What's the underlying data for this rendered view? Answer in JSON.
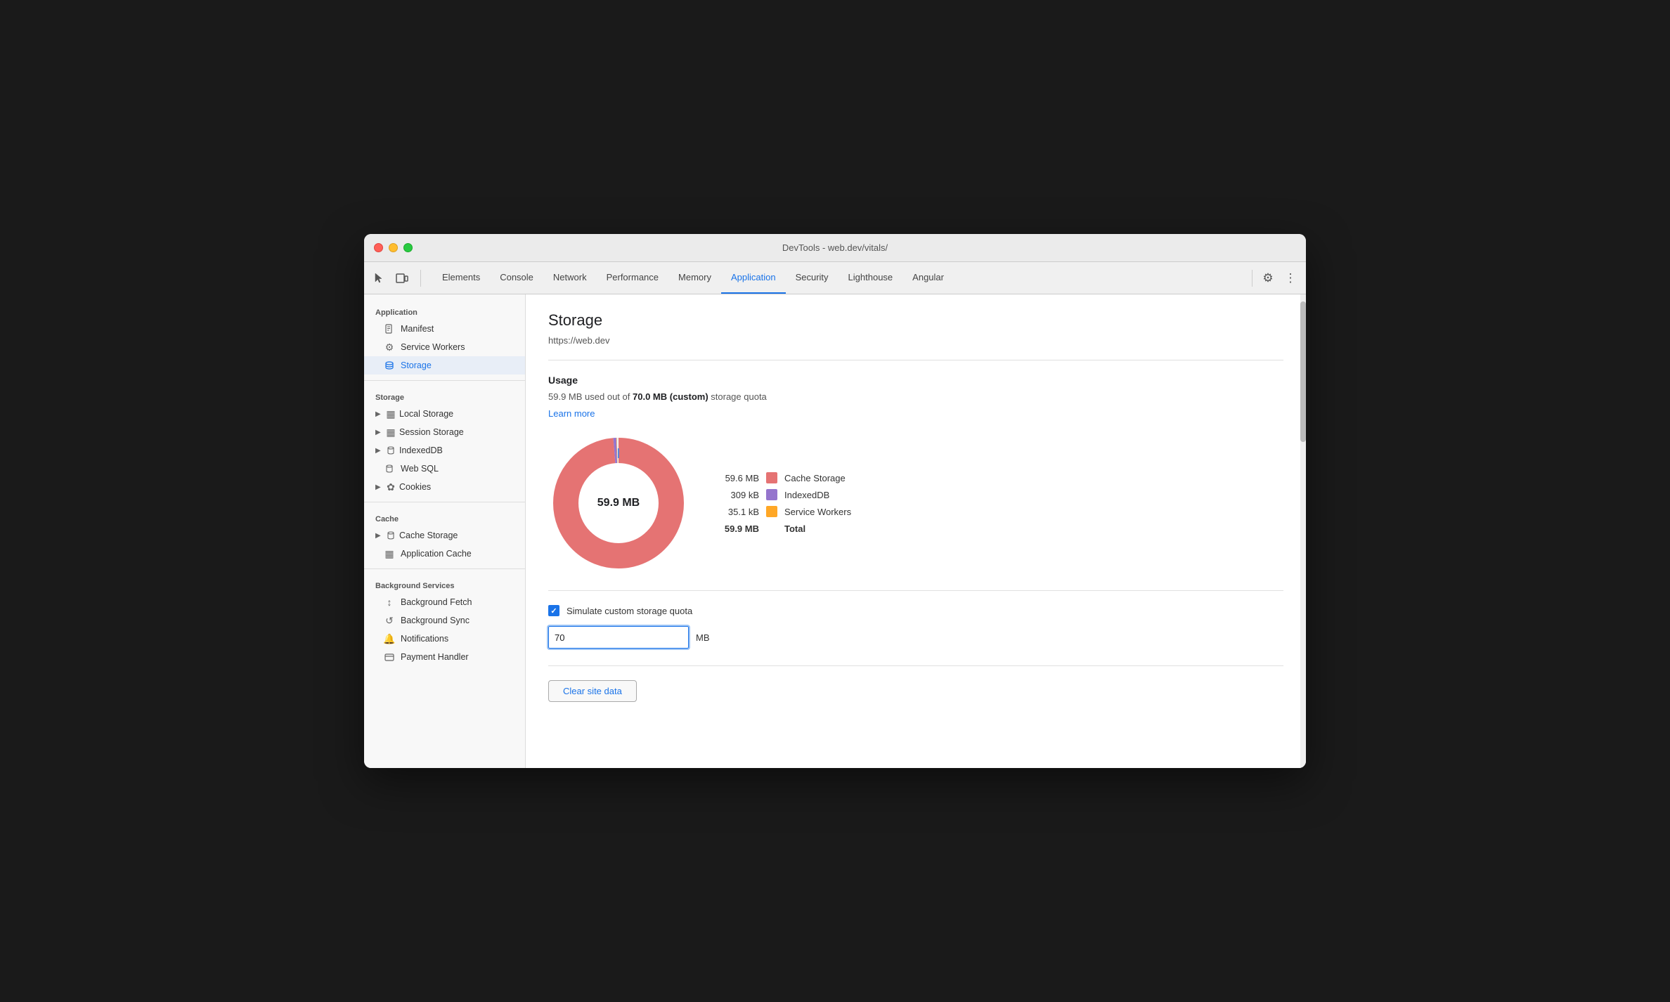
{
  "window": {
    "title": "DevTools - web.dev/vitals/"
  },
  "toolbar": {
    "icons": [
      {
        "name": "cursor-icon",
        "symbol": "⬚"
      },
      {
        "name": "device-icon",
        "symbol": "▣"
      }
    ],
    "tabs": [
      {
        "id": "elements",
        "label": "Elements",
        "active": false
      },
      {
        "id": "console",
        "label": "Console",
        "active": false
      },
      {
        "id": "network",
        "label": "Network",
        "active": false
      },
      {
        "id": "performance",
        "label": "Performance",
        "active": false
      },
      {
        "id": "memory",
        "label": "Memory",
        "active": false
      },
      {
        "id": "application",
        "label": "Application",
        "active": true
      },
      {
        "id": "security",
        "label": "Security",
        "active": false
      },
      {
        "id": "lighthouse",
        "label": "Lighthouse",
        "active": false
      },
      {
        "id": "angular",
        "label": "Angular",
        "active": false
      }
    ],
    "actions": [
      {
        "name": "settings-icon",
        "symbol": "⚙"
      },
      {
        "name": "more-icon",
        "symbol": "⋮"
      }
    ]
  },
  "sidebar": {
    "sections": [
      {
        "label": "Application",
        "items": [
          {
            "id": "manifest",
            "label": "Manifest",
            "icon": "📄",
            "active": false,
            "expandable": false
          },
          {
            "id": "service-workers",
            "label": "Service Workers",
            "icon": "⚙",
            "active": false,
            "expandable": false
          },
          {
            "id": "storage",
            "label": "Storage",
            "icon": "🗄",
            "active": true,
            "expandable": false
          }
        ]
      },
      {
        "label": "Storage",
        "items": [
          {
            "id": "local-storage",
            "label": "Local Storage",
            "icon": "▦",
            "active": false,
            "expandable": true
          },
          {
            "id": "session-storage",
            "label": "Session Storage",
            "icon": "▦",
            "active": false,
            "expandable": true
          },
          {
            "id": "indexeddb",
            "label": "IndexedDB",
            "icon": "🗄",
            "active": false,
            "expandable": true
          },
          {
            "id": "web-sql",
            "label": "Web SQL",
            "icon": "🗄",
            "active": false,
            "expandable": false
          },
          {
            "id": "cookies",
            "label": "Cookies",
            "icon": "✿",
            "active": false,
            "expandable": true
          }
        ]
      },
      {
        "label": "Cache",
        "items": [
          {
            "id": "cache-storage",
            "label": "Cache Storage",
            "icon": "🗄",
            "active": false,
            "expandable": true
          },
          {
            "id": "application-cache",
            "label": "Application Cache",
            "icon": "▦",
            "active": false,
            "expandable": false
          }
        ]
      },
      {
        "label": "Background Services",
        "items": [
          {
            "id": "background-fetch",
            "label": "Background Fetch",
            "icon": "↕",
            "active": false,
            "expandable": false
          },
          {
            "id": "background-sync",
            "label": "Background Sync",
            "icon": "↺",
            "active": false,
            "expandable": false
          },
          {
            "id": "notifications",
            "label": "Notifications",
            "icon": "🔔",
            "active": false,
            "expandable": false
          },
          {
            "id": "payment-handler",
            "label": "Payment Handler",
            "icon": "▬",
            "active": false,
            "expandable": false
          }
        ]
      }
    ]
  },
  "content": {
    "title": "Storage",
    "url": "https://web.dev",
    "usage": {
      "section_title": "Usage",
      "used": "59.9 MB",
      "total": "70.0 MB",
      "quota_type": "(custom)",
      "suffix": "storage quota",
      "prefix": "used out of",
      "learn_more": "Learn more"
    },
    "chart": {
      "center_label": "59.9 MB",
      "segments": [
        {
          "label": "Cache Storage",
          "value": "59.6 MB",
          "color": "#e57373",
          "percentage": 99.5
        },
        {
          "label": "IndexedDB",
          "value": "309 kB",
          "color": "#9575cd",
          "percentage": 0.5
        },
        {
          "label": "Service Workers",
          "value": "35.1 kB",
          "color": "#ffa726",
          "percentage": 0.06
        }
      ],
      "total_label": "Total",
      "total_value": "59.9 MB"
    },
    "simulate": {
      "checkbox_label": "Simulate custom storage quota",
      "checked": true,
      "input_value": "70",
      "input_unit": "MB"
    },
    "clear_button": "Clear site data"
  }
}
